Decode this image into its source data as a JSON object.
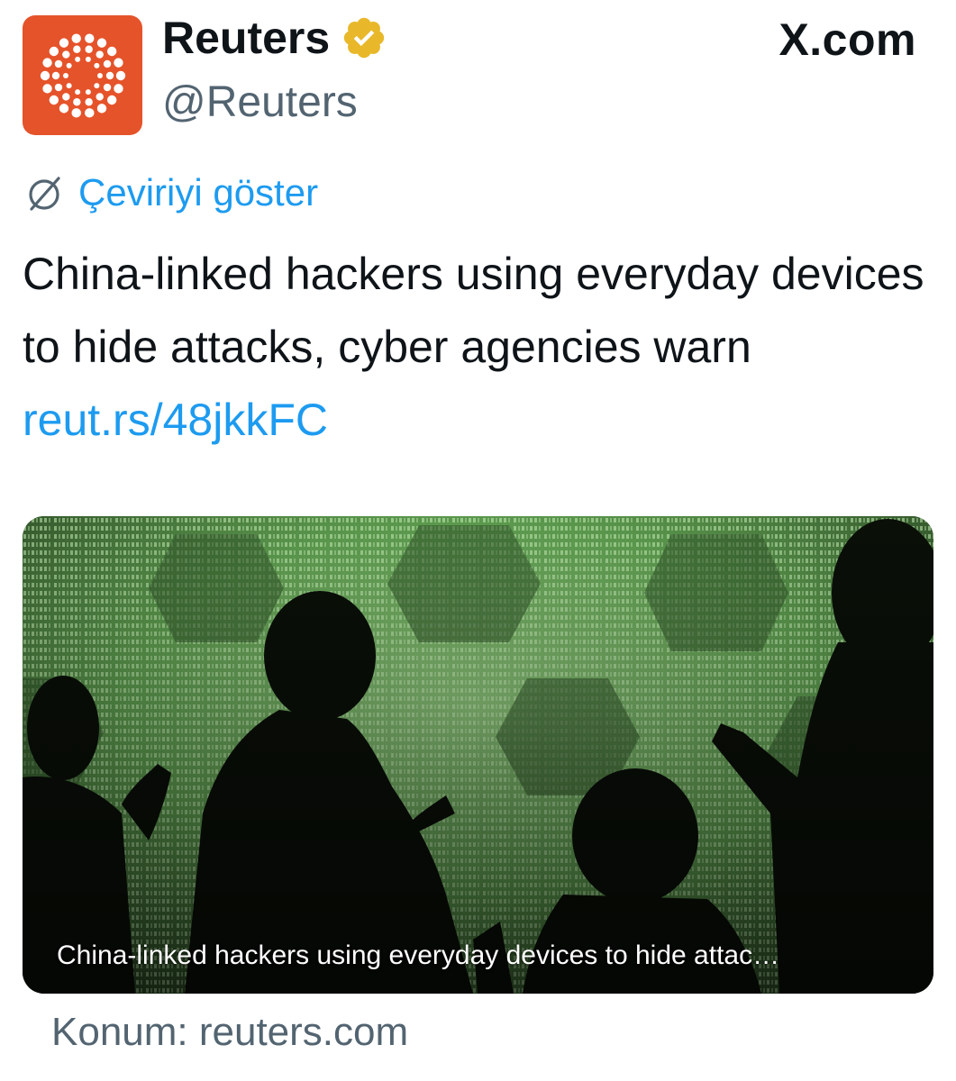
{
  "header": {
    "display_name": "Reuters",
    "handle": "@Reuters",
    "site": "X.com",
    "avatar_icon": "reuters-logo-icon",
    "verified_icon": "verified-badge-icon"
  },
  "translate": {
    "icon": "globe-slash-icon",
    "label": "Çeviriyi göster"
  },
  "tweet": {
    "text": "China-linked hackers using everyday devices to hide attacks, cyber agencies warn ",
    "link_text": "reut.rs/48jkkFC"
  },
  "card": {
    "caption": "China-linked hackers using everyday devices to hide attac…"
  },
  "source": {
    "label": "Konum: reuters.com"
  },
  "colors": {
    "brand_orange": "#e5532a",
    "verified_gold": "#e8b82a",
    "link_blue": "#1d9bf0",
    "secondary_text": "#536471",
    "binary_green": "#5c9a4e"
  }
}
